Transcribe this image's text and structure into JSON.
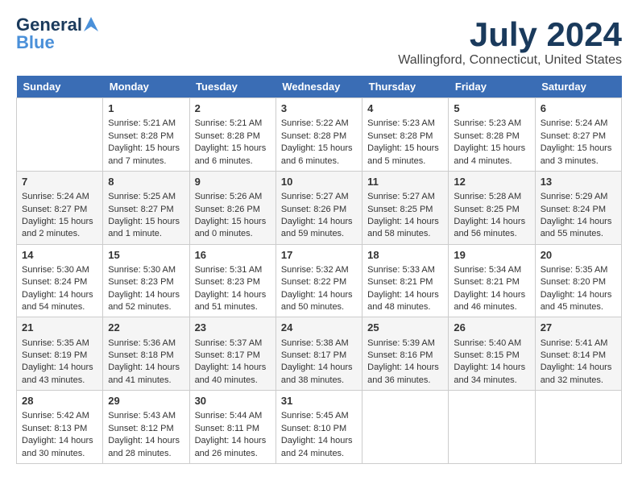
{
  "header": {
    "logo_general": "General",
    "logo_blue": "Blue",
    "month_title": "July 2024",
    "location": "Wallingford, Connecticut, United States"
  },
  "days_of_week": [
    "Sunday",
    "Monday",
    "Tuesday",
    "Wednesday",
    "Thursday",
    "Friday",
    "Saturday"
  ],
  "weeks": [
    [
      {
        "day": "",
        "sunrise": "",
        "sunset": "",
        "daylight": ""
      },
      {
        "day": "1",
        "sunrise": "Sunrise: 5:21 AM",
        "sunset": "Sunset: 8:28 PM",
        "daylight": "Daylight: 15 hours and 7 minutes."
      },
      {
        "day": "2",
        "sunrise": "Sunrise: 5:21 AM",
        "sunset": "Sunset: 8:28 PM",
        "daylight": "Daylight: 15 hours and 6 minutes."
      },
      {
        "day": "3",
        "sunrise": "Sunrise: 5:22 AM",
        "sunset": "Sunset: 8:28 PM",
        "daylight": "Daylight: 15 hours and 6 minutes."
      },
      {
        "day": "4",
        "sunrise": "Sunrise: 5:23 AM",
        "sunset": "Sunset: 8:28 PM",
        "daylight": "Daylight: 15 hours and 5 minutes."
      },
      {
        "day": "5",
        "sunrise": "Sunrise: 5:23 AM",
        "sunset": "Sunset: 8:28 PM",
        "daylight": "Daylight: 15 hours and 4 minutes."
      },
      {
        "day": "6",
        "sunrise": "Sunrise: 5:24 AM",
        "sunset": "Sunset: 8:27 PM",
        "daylight": "Daylight: 15 hours and 3 minutes."
      }
    ],
    [
      {
        "day": "7",
        "sunrise": "Sunrise: 5:24 AM",
        "sunset": "Sunset: 8:27 PM",
        "daylight": "Daylight: 15 hours and 2 minutes."
      },
      {
        "day": "8",
        "sunrise": "Sunrise: 5:25 AM",
        "sunset": "Sunset: 8:27 PM",
        "daylight": "Daylight: 15 hours and 1 minute."
      },
      {
        "day": "9",
        "sunrise": "Sunrise: 5:26 AM",
        "sunset": "Sunset: 8:26 PM",
        "daylight": "Daylight: 15 hours and 0 minutes."
      },
      {
        "day": "10",
        "sunrise": "Sunrise: 5:27 AM",
        "sunset": "Sunset: 8:26 PM",
        "daylight": "Daylight: 14 hours and 59 minutes."
      },
      {
        "day": "11",
        "sunrise": "Sunrise: 5:27 AM",
        "sunset": "Sunset: 8:25 PM",
        "daylight": "Daylight: 14 hours and 58 minutes."
      },
      {
        "day": "12",
        "sunrise": "Sunrise: 5:28 AM",
        "sunset": "Sunset: 8:25 PM",
        "daylight": "Daylight: 14 hours and 56 minutes."
      },
      {
        "day": "13",
        "sunrise": "Sunrise: 5:29 AM",
        "sunset": "Sunset: 8:24 PM",
        "daylight": "Daylight: 14 hours and 55 minutes."
      }
    ],
    [
      {
        "day": "14",
        "sunrise": "Sunrise: 5:30 AM",
        "sunset": "Sunset: 8:24 PM",
        "daylight": "Daylight: 14 hours and 54 minutes."
      },
      {
        "day": "15",
        "sunrise": "Sunrise: 5:30 AM",
        "sunset": "Sunset: 8:23 PM",
        "daylight": "Daylight: 14 hours and 52 minutes."
      },
      {
        "day": "16",
        "sunrise": "Sunrise: 5:31 AM",
        "sunset": "Sunset: 8:23 PM",
        "daylight": "Daylight: 14 hours and 51 minutes."
      },
      {
        "day": "17",
        "sunrise": "Sunrise: 5:32 AM",
        "sunset": "Sunset: 8:22 PM",
        "daylight": "Daylight: 14 hours and 50 minutes."
      },
      {
        "day": "18",
        "sunrise": "Sunrise: 5:33 AM",
        "sunset": "Sunset: 8:21 PM",
        "daylight": "Daylight: 14 hours and 48 minutes."
      },
      {
        "day": "19",
        "sunrise": "Sunrise: 5:34 AM",
        "sunset": "Sunset: 8:21 PM",
        "daylight": "Daylight: 14 hours and 46 minutes."
      },
      {
        "day": "20",
        "sunrise": "Sunrise: 5:35 AM",
        "sunset": "Sunset: 8:20 PM",
        "daylight": "Daylight: 14 hours and 45 minutes."
      }
    ],
    [
      {
        "day": "21",
        "sunrise": "Sunrise: 5:35 AM",
        "sunset": "Sunset: 8:19 PM",
        "daylight": "Daylight: 14 hours and 43 minutes."
      },
      {
        "day": "22",
        "sunrise": "Sunrise: 5:36 AM",
        "sunset": "Sunset: 8:18 PM",
        "daylight": "Daylight: 14 hours and 41 minutes."
      },
      {
        "day": "23",
        "sunrise": "Sunrise: 5:37 AM",
        "sunset": "Sunset: 8:17 PM",
        "daylight": "Daylight: 14 hours and 40 minutes."
      },
      {
        "day": "24",
        "sunrise": "Sunrise: 5:38 AM",
        "sunset": "Sunset: 8:17 PM",
        "daylight": "Daylight: 14 hours and 38 minutes."
      },
      {
        "day": "25",
        "sunrise": "Sunrise: 5:39 AM",
        "sunset": "Sunset: 8:16 PM",
        "daylight": "Daylight: 14 hours and 36 minutes."
      },
      {
        "day": "26",
        "sunrise": "Sunrise: 5:40 AM",
        "sunset": "Sunset: 8:15 PM",
        "daylight": "Daylight: 14 hours and 34 minutes."
      },
      {
        "day": "27",
        "sunrise": "Sunrise: 5:41 AM",
        "sunset": "Sunset: 8:14 PM",
        "daylight": "Daylight: 14 hours and 32 minutes."
      }
    ],
    [
      {
        "day": "28",
        "sunrise": "Sunrise: 5:42 AM",
        "sunset": "Sunset: 8:13 PM",
        "daylight": "Daylight: 14 hours and 30 minutes."
      },
      {
        "day": "29",
        "sunrise": "Sunrise: 5:43 AM",
        "sunset": "Sunset: 8:12 PM",
        "daylight": "Daylight: 14 hours and 28 minutes."
      },
      {
        "day": "30",
        "sunrise": "Sunrise: 5:44 AM",
        "sunset": "Sunset: 8:11 PM",
        "daylight": "Daylight: 14 hours and 26 minutes."
      },
      {
        "day": "31",
        "sunrise": "Sunrise: 5:45 AM",
        "sunset": "Sunset: 8:10 PM",
        "daylight": "Daylight: 14 hours and 24 minutes."
      },
      {
        "day": "",
        "sunrise": "",
        "sunset": "",
        "daylight": ""
      },
      {
        "day": "",
        "sunrise": "",
        "sunset": "",
        "daylight": ""
      },
      {
        "day": "",
        "sunrise": "",
        "sunset": "",
        "daylight": ""
      }
    ]
  ]
}
